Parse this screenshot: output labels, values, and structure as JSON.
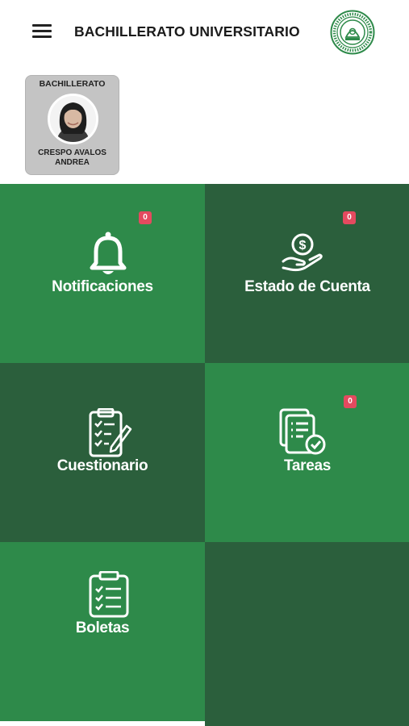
{
  "header": {
    "title": "BACHILLERATO UNIVERSITARIO",
    "menu_icon": "hamburger-menu-icon",
    "logo_icon": "school-seal-logo"
  },
  "profile": {
    "program": "BACHILLERATO",
    "name_line1": "CRESPO AVALOS",
    "name_line2": "ANDREA"
  },
  "tiles": [
    {
      "label": "Notificaciones",
      "icon": "bell-icon",
      "badge": "0"
    },
    {
      "label": "Estado de Cuenta",
      "icon": "money-hand-icon",
      "badge": "0"
    },
    {
      "label": "Cuestionario",
      "icon": "clipboard-checklist-icon"
    },
    {
      "label": "Tareas",
      "icon": "documents-check-icon",
      "badge": "0"
    },
    {
      "label": "Boletas",
      "icon": "clipboard-list-icon"
    }
  ],
  "colors": {
    "tile_light": "#2e8a4a",
    "tile_dark": "#2b5f3c",
    "badge": "#e44a5f",
    "logo_green": "#2e8a4a"
  }
}
